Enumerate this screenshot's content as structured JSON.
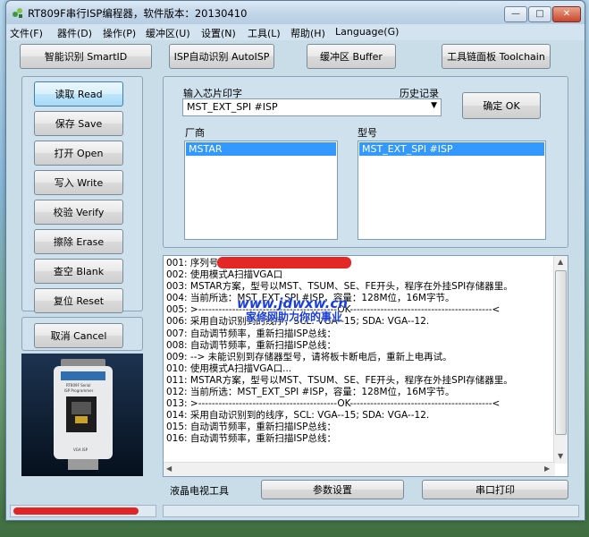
{
  "window": {
    "title": "RT809F串行ISP编程器，软件版本：20130410",
    "min_glyph": "—",
    "max_glyph": "□",
    "close_glyph": "✕"
  },
  "menu": [
    "文件(F)",
    "器件(D)",
    "操作(P)",
    "缓冲区(U)",
    "设置(N)",
    "工具(L)",
    "帮助(H)",
    "Language(G)"
  ],
  "toolbar": {
    "smart_id": "智能识别 SmartID",
    "auto_isp": "ISP自动识别 AutoISP",
    "buffer": "缓冲区 Buffer",
    "toolchain": "工具链面板 Toolchain"
  },
  "actions": {
    "read": "读取 Read",
    "save": "保存 Save",
    "open": "打开 Open",
    "write": "写入 Write",
    "verify": "校验 Verify",
    "erase": "擦除 Erase",
    "blank": "查空 Blank",
    "reset": "复位 Reset",
    "cancel": "取消 Cancel"
  },
  "chip": {
    "input_label": "输入芯片印字",
    "history_label": "历史记录",
    "input_value": "MST_EXT_SPI #ISP",
    "ok_button": "确定 OK",
    "vendor_label": "厂商",
    "vendor_selected": "MSTAR",
    "model_label": "型号",
    "model_selected": "MST_EXT_SPI #ISP"
  },
  "log": [
    "001: 序列号",
    "002: 使用模式A扫描VGA口",
    "003: MSTAR方案，型号以MST、TSUM、SE、FE开头，程序在外挂SPI存储器里。",
    "004: 当前所选：MST_EXT_SPI #ISP，容量：128M位，16M字节。",
    "005: >-----------------------------------------OK------------------------------------------<",
    "006: 采用自动识别到的线序，SCL: VGA--15; SDA: VGA--12.",
    "007: 自动调节频率，重新扫描ISP总线：",
    "008: 自动调节频率，重新扫描ISP总线：",
    "009: --> 未能识别到存储器型号，请将板卡断电后，重新上电再试。",
    "010: 使用模式A扫描VGA口...",
    "011: MSTAR方案，型号以MST、TSUM、SE、FE开头，程序在外挂SPI存储器里。",
    "012: 当前所选：MST_EXT_SPI #ISP，容量：128M位，16M字节。",
    "013: >-----------------------------------------OK------------------------------------------<",
    "014: 采用自动识别到的线序，SCL: VGA--15; SDA: VGA--12.",
    "015: 自动调节频率，重新扫描ISP总线：",
    "016: 自动调节频率，重新扫描ISP总线："
  ],
  "watermark": {
    "url": "www.jdwxw.cn",
    "slogan": "家修网助力你的事业"
  },
  "device_photo": {
    "label_line1": "RT809F Serial",
    "label_line2": "ISP Programmer",
    "port_label": "VGA ISP"
  },
  "tabs": {
    "lcd_tv": "液晶电视工具",
    "params": "参数设置",
    "serial_print": "串口打印"
  },
  "colors": {
    "selection": "#3399ff",
    "watermark": "#1a3fd6",
    "redaction": "#e01010"
  }
}
